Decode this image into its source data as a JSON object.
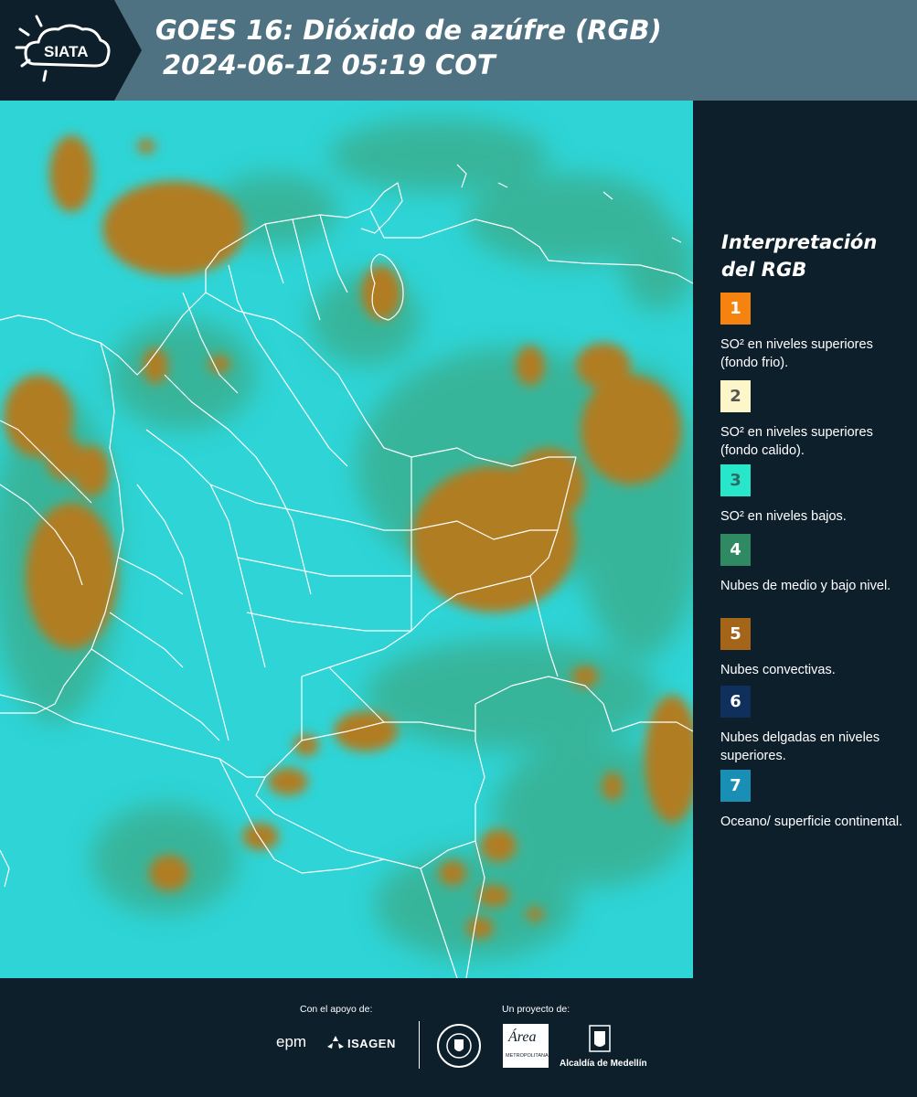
{
  "header": {
    "logo_text": "SIATA",
    "title_line1": "GOES 16: Dióxido de azúfre (RGB)",
    "title_line2": "2024-06-12 05:19 COT"
  },
  "legend": {
    "title": "Interpretación del RGB",
    "items": [
      {
        "number": "1",
        "color": "#f6820f",
        "text_color": "#ffffff",
        "description": "SO² en niveles superiores (fondo frio)."
      },
      {
        "number": "2",
        "color": "#fdf6c8",
        "text_color": "#555555",
        "description": "SO² en niveles superiores (fondo calido)."
      },
      {
        "number": "3",
        "color": "#27e6c9",
        "text_color": "#2c6b69",
        "description": "SO² en niveles bajos."
      },
      {
        "number": "4",
        "color": "#2f8a63",
        "text_color": "#ffffff",
        "description": "Nubes de medio y bajo nivel."
      },
      {
        "number": "5",
        "color": "#a56518",
        "text_color": "#ffffff",
        "description": "Nubes convectivas."
      },
      {
        "number": "6",
        "color": "#0f2f5c",
        "text_color": "#ffffff",
        "description": "Nubes delgadas en niveles superiores."
      },
      {
        "number": "7",
        "color": "#1a8fb5",
        "text_color": "#ffffff",
        "description": "Oceano/ superficie continental."
      }
    ]
  },
  "footer": {
    "support_label": "Con el apoyo de:",
    "project_label": "Un proyecto de:",
    "sponsor_epm": "epm",
    "sponsor_isagen": "ISAGEN",
    "amva_text": "Área",
    "amva_subtext": "METROPOLITANA",
    "alcaldia": "Alcaldía de Medellín"
  },
  "map": {
    "colors": {
      "surface": "#2ed4d6",
      "mid_clouds": "#3f9c6c",
      "convective": "#b07d23",
      "borders": "#ffffff"
    }
  }
}
